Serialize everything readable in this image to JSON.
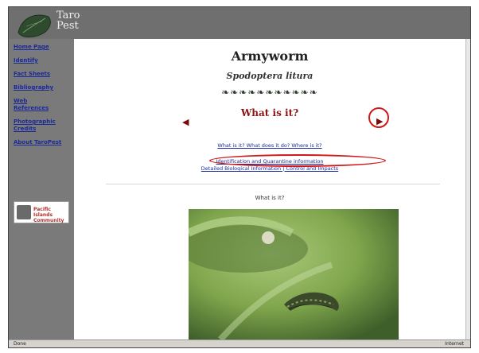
{
  "header": {
    "logo_text_line1": "Taro",
    "logo_text_line2": "Pest"
  },
  "sidebar": {
    "items": [
      {
        "label": "Home Page"
      },
      {
        "label": "Identify"
      },
      {
        "label": "Fact Sheets"
      },
      {
        "label": "Bibliography"
      },
      {
        "label": "Web References"
      },
      {
        "label": "Photographic Credits"
      },
      {
        "label": "About TaroPest"
      }
    ],
    "badge_text": "Pacific Islands Community"
  },
  "main": {
    "title": "Armyworm",
    "scientific_name": "Spodoptera litura",
    "leaf_divider": "❧❧❧❧❧❧❧❧❧❧❧",
    "section_title": "What is it?",
    "links_row1": "What is it? What does it do? Where is it?",
    "links_row2": "Identification and Quarantine information",
    "links_row3": "Detailed Biological Information | Control and Impacts",
    "subheading": "What is it?"
  },
  "status": {
    "left": "Done",
    "right": "Internet"
  },
  "colors": {
    "sidebar_bg": "#7a7a7a",
    "link": "#1a2a9a",
    "accent_red": "#d01818",
    "title_dark_red": "#8a1414"
  }
}
